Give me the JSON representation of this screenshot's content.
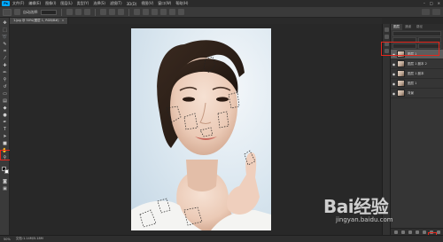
{
  "menubar": {
    "app_badge": "Ps",
    "items": [
      "文件(F)",
      "编辑(E)",
      "图像(I)",
      "图层(L)",
      "类型(Y)",
      "选择(S)",
      "滤镜(T)",
      "3D(D)",
      "视图(V)",
      "窗口(W)",
      "帮助(H)"
    ]
  },
  "optionsbar": {
    "tool_label": "自动选择:",
    "layer_label": "组"
  },
  "document": {
    "tab_title": "1.jpg @ 50%(图层 1, RGB/8#)"
  },
  "toolbar": {
    "tools": [
      "move-icon",
      "marquee-icon",
      "lasso-icon",
      "quick-select-icon",
      "crop-icon",
      "eyedropper-icon",
      "healing-icon",
      "brush-icon",
      "stamp-icon",
      "history-brush-icon",
      "eraser-icon",
      "gradient-icon",
      "blur-icon",
      "dodge-icon",
      "pen-icon",
      "type-icon",
      "path-select-icon",
      "shape-icon",
      "hand-icon",
      "zoom-icon"
    ],
    "foreground_color": "#000000",
    "background_color": "#ffffff"
  },
  "layers_panel": {
    "tabs": [
      "图层",
      "通道",
      "路径"
    ],
    "layers": [
      {
        "name": "图层 1",
        "visible": true,
        "active": true
      },
      {
        "name": "图层 1 副本 2",
        "visible": true,
        "active": false
      },
      {
        "name": "图层 1 副本",
        "visible": true,
        "active": false
      },
      {
        "name": "图层 1",
        "visible": true,
        "active": false
      },
      {
        "name": "背景",
        "visible": true,
        "active": false
      }
    ]
  },
  "statusbar": {
    "zoom": "50%",
    "doc_info": "文档:1.14M/5.18M"
  },
  "watermark": {
    "brand": "Bai经验",
    "url": "jingyan.baidu.com"
  },
  "highlight_color": "#e4261c"
}
